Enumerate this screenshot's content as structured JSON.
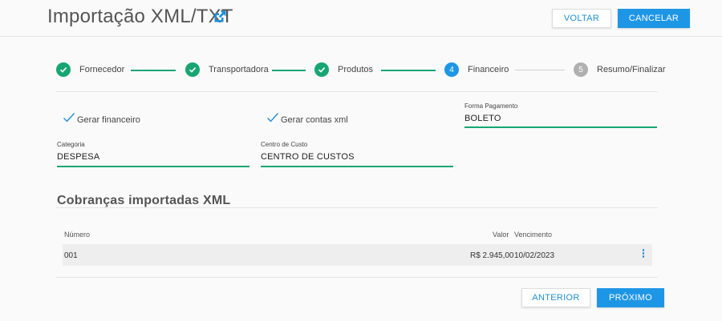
{
  "header": {
    "title": "Importação XML/TXT",
    "title_icon": "external-link-icon",
    "voltar_label": "VOLTAR",
    "cancelar_label": "CANCELAR"
  },
  "stepper": {
    "steps": [
      {
        "label": "Fornecedor",
        "status": "done"
      },
      {
        "label": "Transportadora",
        "status": "done"
      },
      {
        "label": "Produtos",
        "status": "done"
      },
      {
        "label": "Financeiro",
        "status": "active",
        "number": "4"
      },
      {
        "label": "Resumo/Finalizar",
        "status": "pending",
        "number": "5"
      }
    ]
  },
  "form": {
    "gerar_financeiro": {
      "label": "Gerar financeiro",
      "checked": true
    },
    "gerar_contas_xml": {
      "label": "Gerar contas xml",
      "checked": true
    },
    "forma_pagamento": {
      "label": "Forma Pagamento",
      "value": "BOLETO"
    },
    "categoria": {
      "label": "Categoria",
      "value": "DESPESA"
    },
    "centro_custo": {
      "label": "Centro de Custo",
      "value": "CENTRO DE CUSTOS"
    }
  },
  "cobrancas": {
    "title": "Cobranças importadas XML",
    "columns": {
      "numero": "Número",
      "valor": "Valor",
      "vencimento": "Vencimento"
    },
    "rows": [
      {
        "numero": "001",
        "valor": "R$ 2.945,00",
        "vencimento": "10/02/2023"
      }
    ]
  },
  "footer": {
    "anterior_label": "ANTERIOR",
    "proximo_label": "PRÓXIMO"
  },
  "colors": {
    "primary": "#1e96e6",
    "success": "#17a673",
    "pending": "#b0b0b0"
  }
}
